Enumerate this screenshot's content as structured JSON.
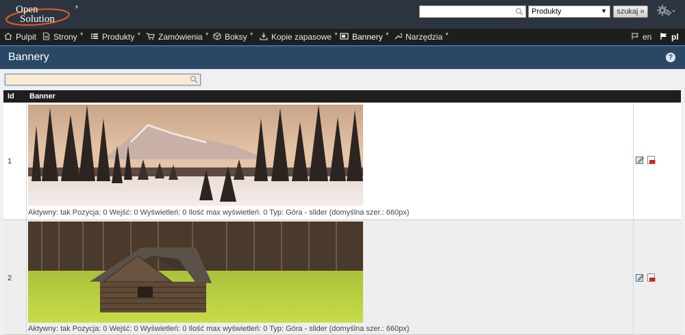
{
  "header": {
    "logo_line1": "Open",
    "logo_line2": "Solution",
    "search": {
      "value": "",
      "placeholder": ""
    },
    "search_scope": "Produkty",
    "search_button": "szukaj »"
  },
  "nav": {
    "items": [
      {
        "label": "Pulpit",
        "icon": "home-icon",
        "caret": false
      },
      {
        "label": "Strony",
        "icon": "page-icon",
        "caret": true
      },
      {
        "label": "Produkty",
        "icon": "list-icon",
        "caret": true
      },
      {
        "label": "Zamówienia",
        "icon": "cart-icon",
        "caret": true
      },
      {
        "label": "Boksy",
        "icon": "cube-icon",
        "caret": true
      },
      {
        "label": "Kopie zapasowe",
        "icon": "download-icon",
        "caret": true
      },
      {
        "label": "Bannery",
        "icon": "banner-icon",
        "caret": true
      },
      {
        "label": "Narzędzia",
        "icon": "wrench-icon",
        "caret": true
      }
    ],
    "languages": [
      {
        "label": "en",
        "icon": "flag-icon"
      },
      {
        "label": "pl",
        "icon": "flag-icon"
      }
    ]
  },
  "page": {
    "title": "Bannery",
    "help": "?",
    "filter": {
      "value": "",
      "placeholder": ""
    }
  },
  "table": {
    "columns": [
      "Id",
      "Banner"
    ],
    "rows": [
      {
        "id": "1",
        "image": "winter-forest-banner",
        "meta": "Aktywny: tak   Pozycja: 0   Wejść: 0   Wyświetleń: 0   Ilość max wyświetleń: 0   Typ: Góra - slider (domyślna szer.: 660px)"
      },
      {
        "id": "2",
        "image": "wooden-cabin-meadow-banner",
        "meta": "Aktywny: tak   Pozycja: 0   Wejść: 0   Wyświetleń: 0   Ilość max wyświetleń: 0   Typ: Góra - slider (domyślna szer.: 660px)"
      }
    ]
  },
  "colors": {
    "topbar": "#2c3440",
    "nav": "#1e1e1e",
    "pagehead": "#2a4866",
    "logo_orange": "#e05a1c"
  }
}
